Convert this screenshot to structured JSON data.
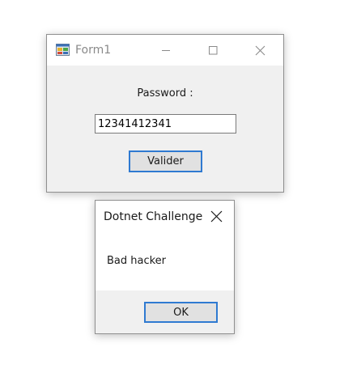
{
  "form1": {
    "title": "Form1",
    "password_label": "Password :",
    "password_value": "12341412341",
    "validate_label": "Valider"
  },
  "message_box": {
    "title": "Dotnet Challenge",
    "message": "Bad hacker",
    "ok_label": "OK"
  },
  "icons": {
    "app": "winforms-app-icon",
    "minimize": "minimize-icon",
    "maximize": "maximize-icon",
    "close": "close-icon"
  },
  "colors": {
    "accent": "#2f7ad1",
    "client_bg": "#f0f0f0",
    "titlebar_bg": "#ffffff",
    "inactive_title_text": "#8a8a8a"
  }
}
